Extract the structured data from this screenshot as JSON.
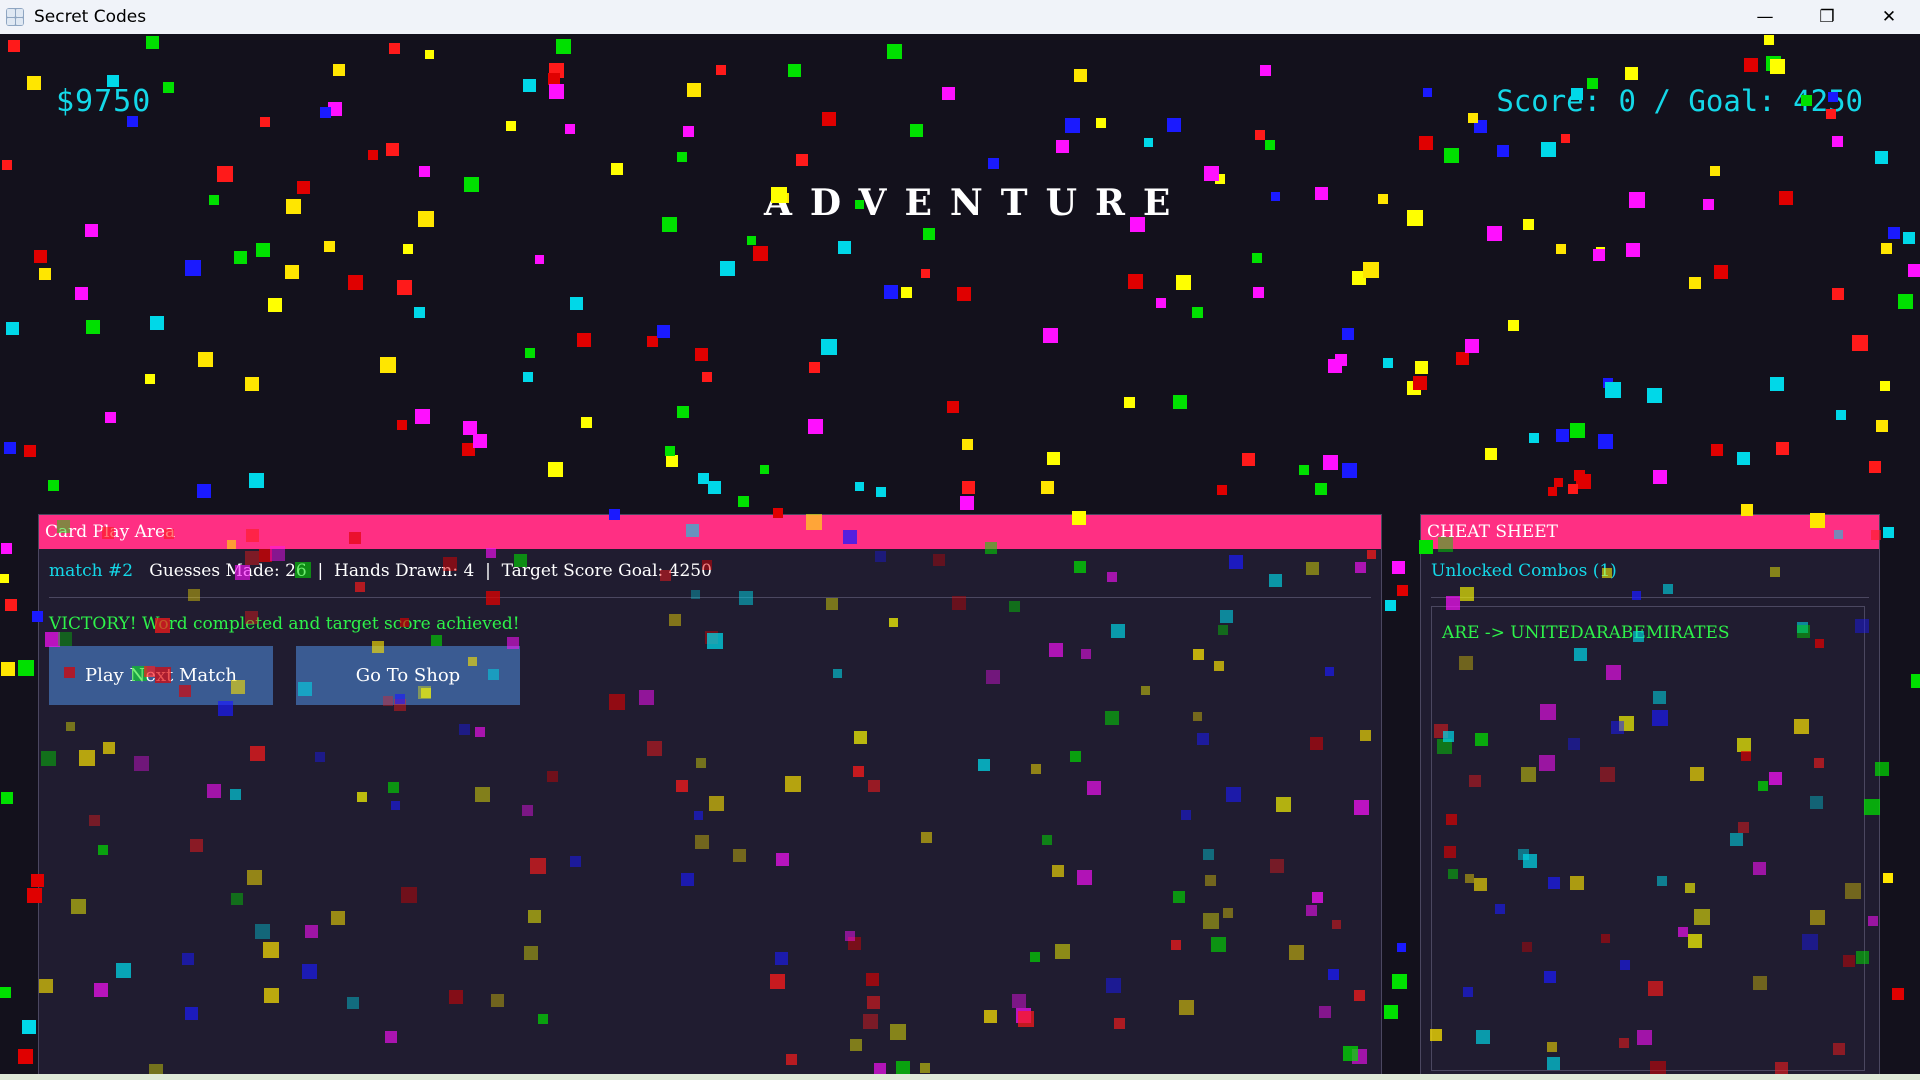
{
  "window": {
    "title": "Secret Codes",
    "minimize_glyph": "—",
    "maximize_glyph": "❐",
    "close_glyph": "✕"
  },
  "hud": {
    "money": "$9750",
    "score": "Score: 0 / Goal: 4250",
    "mode_title": "ADVENTURE"
  },
  "play_area": {
    "header": "Card Play Area",
    "match_label": "match #2",
    "stats": "   Guesses Made: 26  |  Hands Drawn: 4  |  Target Score Goal: 4250",
    "message": "VICTORY! Word completed and target score achieved!",
    "buttons": {
      "next": "Play Next Match",
      "shop": "Go To Shop"
    }
  },
  "cheat_sheet": {
    "header": "CHEAT SHEET",
    "unlocked_label": "Unlocked Combos (1)",
    "combos": [
      "ARE -> UNITEDARABEMIRATES"
    ]
  },
  "colors": {
    "accent_pink": "#ff2f83",
    "cyan": "#14d8e8",
    "green": "#2ef24a",
    "button_blue": "#3a5b92",
    "background": "#13111c",
    "panel": "#201c30"
  },
  "confetti": {
    "count": 520,
    "palette": [
      "#ff1a1a",
      "#00e000",
      "#1a1aff",
      "#ffff00",
      "#00d8e8",
      "#ff10ff",
      "#e00000",
      "#ffe600"
    ]
  }
}
